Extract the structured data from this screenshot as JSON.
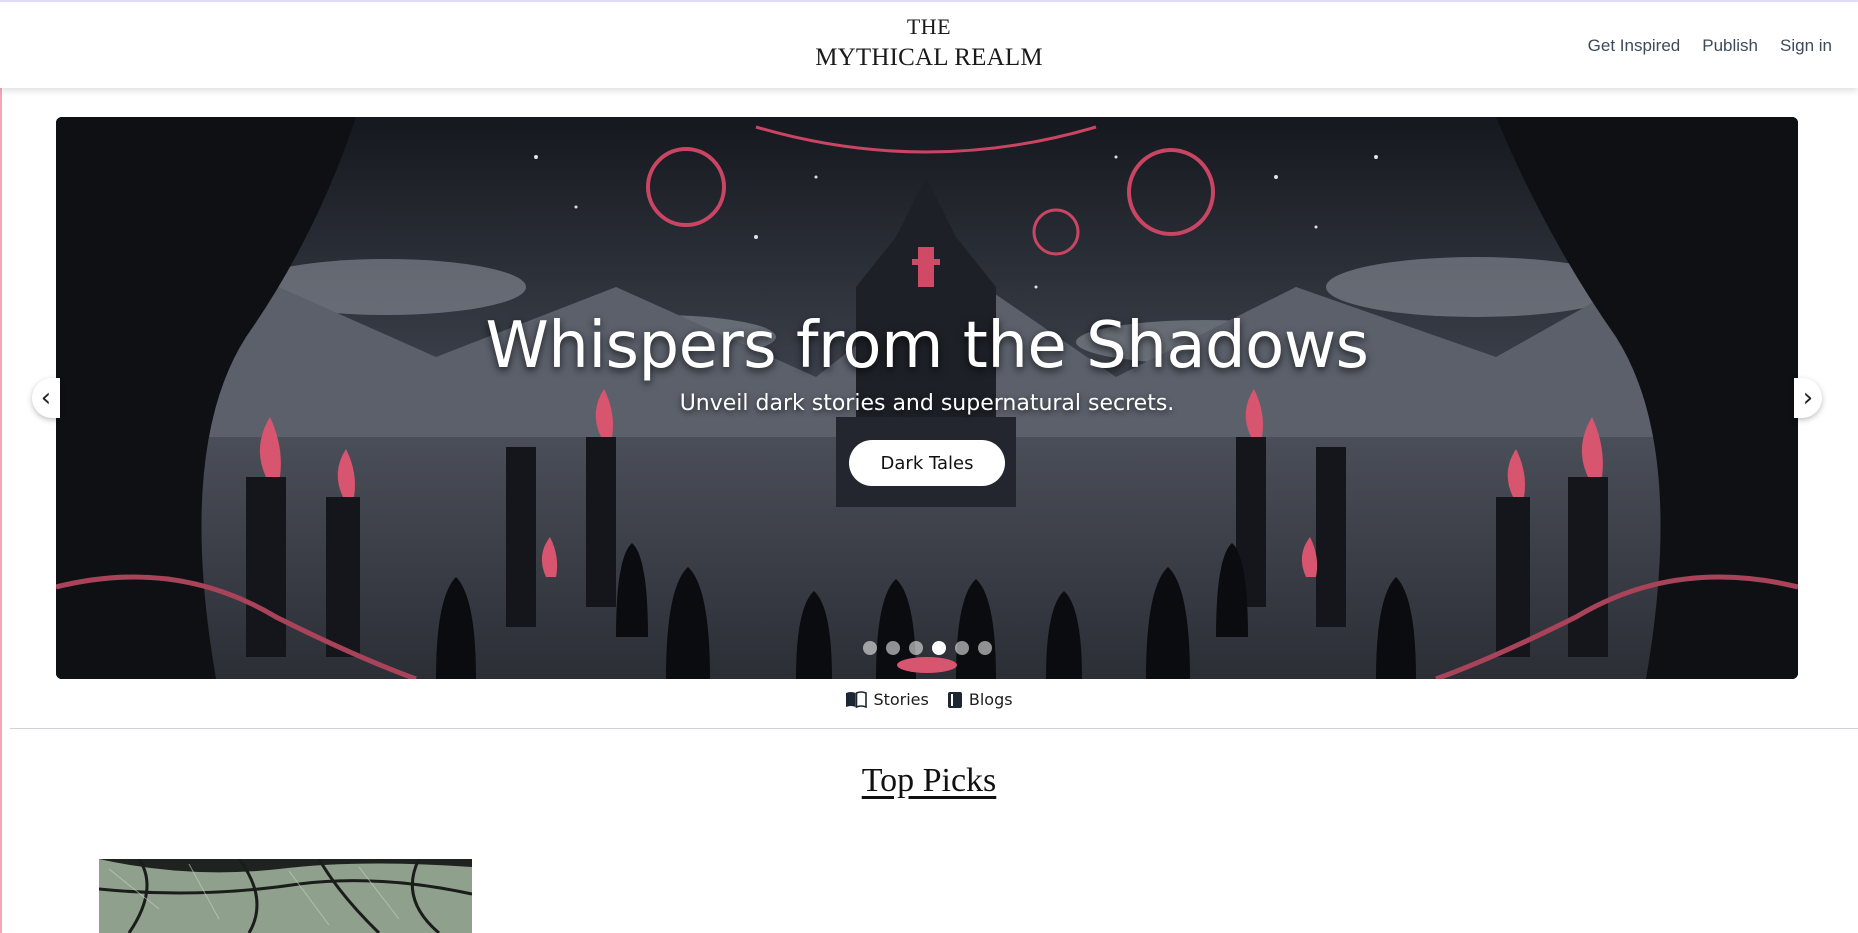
{
  "brand": {
    "line1": "THE",
    "line2": "MYTHICAL REALM"
  },
  "nav": {
    "get_inspired": "Get Inspired",
    "publish": "Publish",
    "sign_in": "Sign in"
  },
  "hero": {
    "title": "Whispers from the Shadows",
    "subtitle": "Unveil dark stories and supernatural secrets.",
    "button": "Dark Tales",
    "slide_count": 6,
    "active_slide": 4
  },
  "carousel": {
    "prev_icon": "‹",
    "next_icon": "›"
  },
  "tabs": [
    {
      "label": "Stories",
      "icon": "open-book-icon"
    },
    {
      "label": "Blogs",
      "icon": "closed-book-icon"
    }
  ],
  "section": {
    "title": "Top Picks"
  },
  "colors": {
    "accent": "#e05a78",
    "text": "#3e4a5a"
  }
}
